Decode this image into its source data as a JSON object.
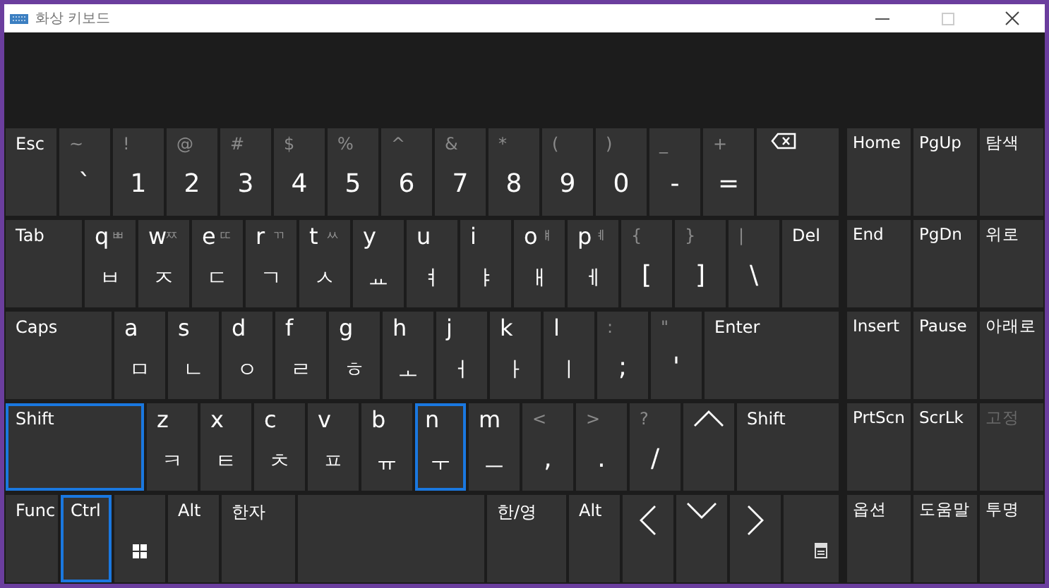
{
  "window": {
    "title": "화상 키보드"
  },
  "rows": [
    {
      "keys": [
        {
          "kind": "text",
          "label": "Esc",
          "selected": false
        },
        {
          "kind": "char",
          "shift": "~",
          "char": "`",
          "selected": false
        },
        {
          "kind": "char",
          "shift": "!",
          "char": "1",
          "selected": false
        },
        {
          "kind": "char",
          "shift": "@",
          "char": "2",
          "selected": false
        },
        {
          "kind": "char",
          "shift": "#",
          "char": "3",
          "selected": false
        },
        {
          "kind": "char",
          "shift": "$",
          "char": "4",
          "selected": false
        },
        {
          "kind": "char",
          "shift": "%",
          "char": "5",
          "selected": false
        },
        {
          "kind": "char",
          "shift": "^",
          "char": "6",
          "selected": false
        },
        {
          "kind": "char",
          "shift": "&",
          "char": "7",
          "selected": false
        },
        {
          "kind": "char",
          "shift": "*",
          "char": "8",
          "selected": false
        },
        {
          "kind": "char",
          "shift": "(",
          "char": "9",
          "selected": false
        },
        {
          "kind": "char",
          "shift": ")",
          "char": "0",
          "selected": false
        },
        {
          "kind": "char",
          "shift": "_",
          "char": "-",
          "selected": false
        },
        {
          "kind": "char",
          "shift": "+",
          "char": "=",
          "selected": false
        },
        {
          "kind": "backspace",
          "selected": false
        }
      ]
    },
    {
      "keys": [
        {
          "kind": "text",
          "label": "Tab",
          "selected": false
        },
        {
          "kind": "letter",
          "label": "q",
          "alt": "ㅃ",
          "char": "ㅂ",
          "selected": false
        },
        {
          "kind": "letter",
          "label": "w",
          "alt": "ㅉ",
          "char": "ㅈ",
          "selected": false
        },
        {
          "kind": "letter",
          "label": "e",
          "alt": "ㄸ",
          "char": "ㄷ",
          "selected": false
        },
        {
          "kind": "letter",
          "label": "r",
          "alt": "ㄲ",
          "char": "ㄱ",
          "selected": false
        },
        {
          "kind": "letter",
          "label": "t",
          "alt": "ㅆ",
          "char": "ㅅ",
          "selected": false
        },
        {
          "kind": "letter",
          "label": "y",
          "char": "ㅛ",
          "selected": false
        },
        {
          "kind": "letter",
          "label": "u",
          "char": "ㅕ",
          "selected": false
        },
        {
          "kind": "letter",
          "label": "i",
          "char": "ㅑ",
          "selected": false
        },
        {
          "kind": "letter",
          "label": "o",
          "alt": "ㅒ",
          "char": "ㅐ",
          "selected": false
        },
        {
          "kind": "letter",
          "label": "p",
          "alt": "ㅖ",
          "char": "ㅔ",
          "selected": false
        },
        {
          "kind": "char",
          "shift": "{",
          "char": "[",
          "selected": false
        },
        {
          "kind": "char",
          "shift": "}",
          "char": "]",
          "selected": false
        },
        {
          "kind": "char",
          "shift": "|",
          "char": "\\",
          "selected": false
        },
        {
          "kind": "text",
          "label": "Del",
          "selected": false
        }
      ]
    },
    {
      "keys": [
        {
          "kind": "text",
          "label": "Caps",
          "selected": false
        },
        {
          "kind": "letter",
          "label": "a",
          "char": "ㅁ",
          "selected": false
        },
        {
          "kind": "letter",
          "label": "s",
          "char": "ㄴ",
          "selected": false
        },
        {
          "kind": "letter",
          "label": "d",
          "char": "ㅇ",
          "selected": false
        },
        {
          "kind": "letter",
          "label": "f",
          "char": "ㄹ",
          "selected": false
        },
        {
          "kind": "letter",
          "label": "g",
          "char": "ㅎ",
          "selected": false
        },
        {
          "kind": "letter",
          "label": "h",
          "char": "ㅗ",
          "selected": false
        },
        {
          "kind": "letter",
          "label": "j",
          "char": "ㅓ",
          "selected": false
        },
        {
          "kind": "letter",
          "label": "k",
          "char": "ㅏ",
          "selected": false
        },
        {
          "kind": "letter",
          "label": "l",
          "char": "ㅣ",
          "selected": false
        },
        {
          "kind": "char",
          "shift": ":",
          "char": ";",
          "selected": false
        },
        {
          "kind": "char",
          "shift": "\"",
          "char": "'",
          "selected": false
        },
        {
          "kind": "text",
          "label": "Enter",
          "selected": false
        }
      ]
    },
    {
      "keys": [
        {
          "kind": "text",
          "label": "Shift",
          "selected": true
        },
        {
          "kind": "letter",
          "label": "z",
          "char": "ㅋ",
          "selected": false
        },
        {
          "kind": "letter",
          "label": "x",
          "char": "ㅌ",
          "selected": false
        },
        {
          "kind": "letter",
          "label": "c",
          "char": "ㅊ",
          "selected": false
        },
        {
          "kind": "letter",
          "label": "v",
          "char": "ㅍ",
          "selected": false
        },
        {
          "kind": "letter",
          "label": "b",
          "char": "ㅠ",
          "selected": false
        },
        {
          "kind": "letter",
          "label": "n",
          "char": "ㅜ",
          "selected": true
        },
        {
          "kind": "letter",
          "label": "m",
          "char": "ㅡ",
          "selected": false
        },
        {
          "kind": "char",
          "shift": "<",
          "char": ",",
          "selected": false
        },
        {
          "kind": "char",
          "shift": ">",
          "char": ".",
          "selected": false
        },
        {
          "kind": "char",
          "shift": "?",
          "char": "/",
          "selected": false
        },
        {
          "kind": "up",
          "selected": false
        },
        {
          "kind": "text",
          "label": "Shift",
          "selected": false
        }
      ]
    },
    {
      "keys": [
        {
          "kind": "text",
          "label": "Func",
          "selected": false
        },
        {
          "kind": "text",
          "label": "Ctrl",
          "selected": true
        },
        {
          "kind": "windows",
          "selected": false
        },
        {
          "kind": "text",
          "label": "Alt",
          "selected": false
        },
        {
          "kind": "text",
          "label": "한자",
          "selected": false
        },
        {
          "kind": "space",
          "selected": false
        },
        {
          "kind": "text",
          "label": "한/영",
          "selected": false
        },
        {
          "kind": "text",
          "label": "Alt",
          "selected": false
        },
        {
          "kind": "left",
          "selected": false
        },
        {
          "kind": "down",
          "selected": false
        },
        {
          "kind": "right",
          "selected": false
        },
        {
          "kind": "menu",
          "selected": false
        }
      ]
    }
  ],
  "nav_keys": [
    {
      "label": "Home",
      "disabled": false
    },
    {
      "label": "PgUp",
      "disabled": false
    },
    {
      "label": "탐색",
      "disabled": false
    },
    {
      "label": "End",
      "disabled": false
    },
    {
      "label": "PgDn",
      "disabled": false
    },
    {
      "label": "위로",
      "disabled": false
    },
    {
      "label": "Insert",
      "disabled": false
    },
    {
      "label": "Pause",
      "disabled": false
    },
    {
      "label": "아래로",
      "disabled": false
    },
    {
      "label": "PrtScn",
      "disabled": false
    },
    {
      "label": "ScrLk",
      "disabled": false
    },
    {
      "label": "고정",
      "disabled": true
    },
    {
      "label": "옵션",
      "disabled": false
    },
    {
      "label": "도움말",
      "disabled": false
    },
    {
      "label": "투명",
      "disabled": false
    }
  ]
}
